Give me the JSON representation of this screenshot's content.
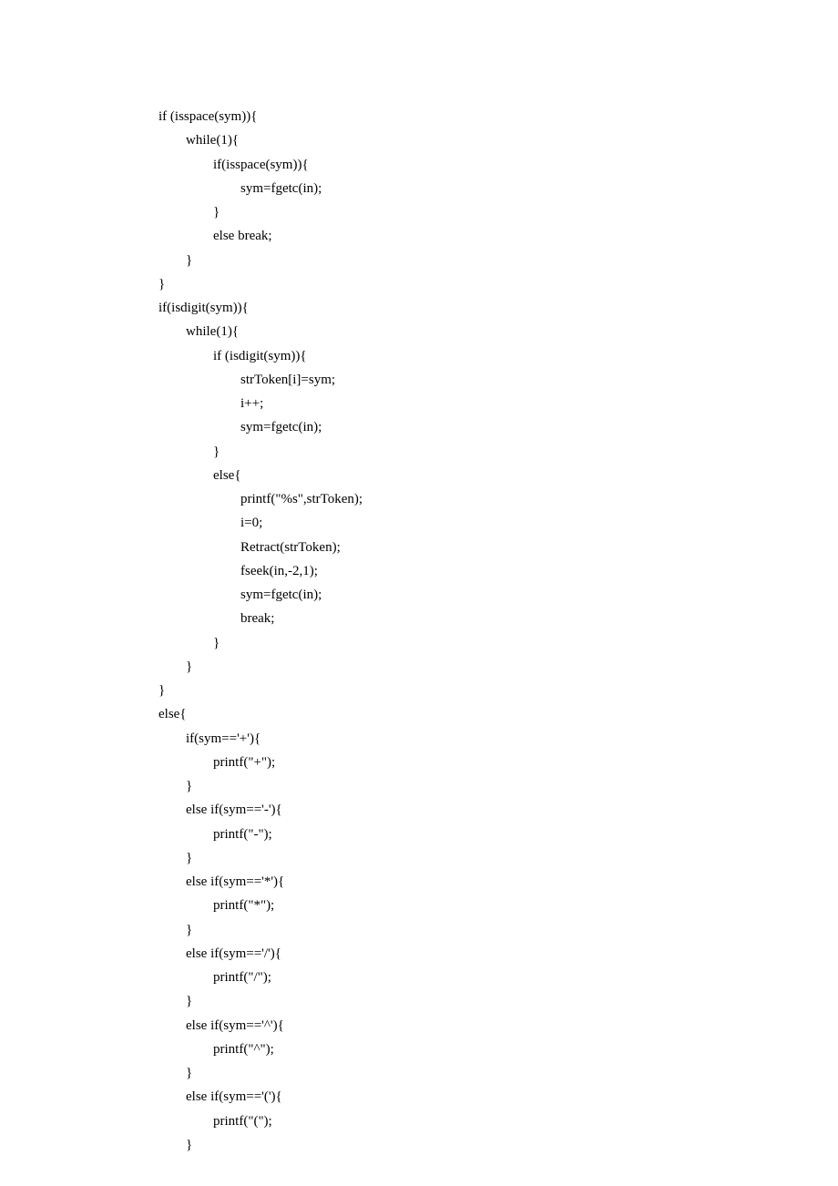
{
  "code": {
    "lines": [
      "if (isspace(sym)){",
      "        while(1){",
      "                if(isspace(sym)){",
      "                        sym=fgetc(in);",
      "                }",
      "                else break;",
      "        }",
      "}",
      "if(isdigit(sym)){",
      "        while(1){",
      "                if (isdigit(sym)){",
      "                        strToken[i]=sym;",
      "                        i++;",
      "                        sym=fgetc(in);",
      "                }",
      "                else{",
      "                        printf(\"%s\",strToken);",
      "                        i=0;",
      "                        Retract(strToken);",
      "                        fseek(in,-2,1);",
      "                        sym=fgetc(in);",
      "                        break;",
      "                }",
      "        }",
      "}",
      "else{",
      "        if(sym=='+'){",
      "                printf(\"+\");",
      "        }",
      "        else if(sym=='-'){",
      "                printf(\"-\");",
      "        }",
      "        else if(sym=='*'){",
      "                printf(\"*\");",
      "        }",
      "        else if(sym=='/'){",
      "                printf(\"/\");",
      "        }",
      "        else if(sym=='^'){",
      "                printf(\"^\");",
      "        }",
      "        else if(sym=='('){",
      "                printf(\"(\");",
      "        }"
    ]
  }
}
